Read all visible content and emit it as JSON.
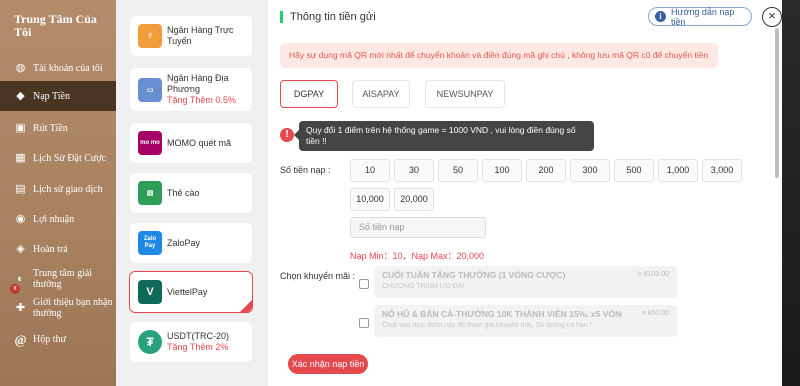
{
  "sidebar": {
    "title": "Trung Tâm Của Tôi",
    "items": [
      {
        "label": "Tài khoản của tôi",
        "icon": "user-icon"
      },
      {
        "label": "Nạp Tiền",
        "icon": "wallet-icon",
        "active": true
      },
      {
        "label": "Rút Tiền",
        "icon": "withdraw-icon"
      },
      {
        "label": "Lịch Sử Đặt Cược",
        "icon": "bet-history-icon"
      },
      {
        "label": "Lịch sử giao dịch",
        "icon": "transaction-icon"
      },
      {
        "label": "Lợi nhuận",
        "icon": "profit-icon"
      },
      {
        "label": "Hoàn trả",
        "icon": "refund-icon"
      },
      {
        "label": "Trung tâm giải thưởng",
        "icon": "prize-icon"
      },
      {
        "label": "Giới thiệu bạn nhận thưởng",
        "icon": "referral-icon"
      },
      {
        "label": "Hộp thư",
        "icon": "mail-icon"
      }
    ],
    "badge": "x"
  },
  "methods": [
    {
      "label": "Ngân Hàng Trực Tuyến",
      "bonus": "",
      "logo_text": "₫",
      "color": "#f39c3c"
    },
    {
      "label": "Ngân Hàng Địa Phương",
      "bonus": "Tặng Thêm 0.5%",
      "logo_text": "▭",
      "color": "#6a8fd1"
    },
    {
      "label": "MOMO quét mã",
      "bonus": "",
      "logo_text": "mo mo",
      "color": "#a50064"
    },
    {
      "label": "Thẻ cào",
      "bonus": "",
      "logo_text": "▤",
      "color": "#2e9d57"
    },
    {
      "label": "ZaloPay",
      "bonus": "",
      "logo_text": "Zalo Pay",
      "color": "#1e88e5"
    },
    {
      "label": "ViettelPay",
      "bonus": "",
      "logo_text": "V",
      "color": "#0f6a5a"
    },
    {
      "label": "USDT(TRC-20)",
      "bonus": "Tặng Thêm 2%",
      "logo_text": "₮",
      "color": "#26a17b"
    }
  ],
  "main": {
    "title": "Thông tin tiền gửi",
    "guide_label": "Hướng dẫn nạp tiền",
    "close_label": "×",
    "notice": "Hãy sự dụng mã QR mới nhất để chuyển khoản và điền đúng mã ghi chú , không lưu mã QR cũ để chuyển tiền",
    "tabs": [
      "DGPAY",
      "AISAPAY",
      "NEWSUNPAY"
    ],
    "tooltip": "Quy đổi 1 điểm trên hệ thống game = 1000 VND , vui lòng điền đúng số tiền !!",
    "amount_label": "Số tiền nạp :",
    "amounts": [
      "10",
      "30",
      "50",
      "100",
      "200",
      "300",
      "500",
      "1,000",
      "3,000",
      "10,000",
      "20,000"
    ],
    "amount_placeholder": "Số tiền nạp",
    "min_max": "Nạp Min：10，Nạp Max：20,000",
    "promo_label": "Chọn khuyến mãi :",
    "promos": [
      {
        "title": "CUỐI TUẦN TẶNG THƯỞNG (1 VÒNG CƯỢC)",
        "sub": "CHƯƠNG TRÌNH ƯU ĐÃI",
        "range": "> 8100.00"
      },
      {
        "title": "NỔ HŨ & BẮN CÁ-THƯỞNG 10K THÀNH VIÊN 15%, x5 VÒNG CƯ...",
        "sub": "Click vào mục dưới này để tham gia khuyến mãi, Số lượng có hạn !",
        "range": "> 850.00"
      }
    ],
    "submit_label": "Xác nhận nạp tiền"
  }
}
